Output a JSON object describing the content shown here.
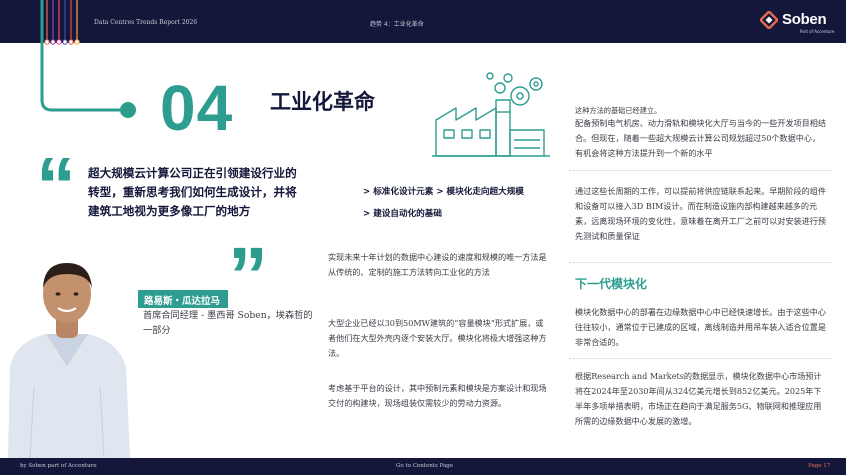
{
  "header": {
    "report": "Data Centres Trends Report 2026",
    "trend": "趋势 4：工业化革命",
    "logo_name": "Soben",
    "logo_sub": "Part of Accenture"
  },
  "section": {
    "number": "04",
    "title": "工业化革命"
  },
  "pull_quote": {
    "open_mark": "“",
    "close_mark": "”",
    "text": "超大规模云计算公司正在引领建设行业的转型，重新思考我们如何生成设计，并将建筑工地视为更多像工厂的地方"
  },
  "person": {
    "name": "路易斯・瓜达拉马",
    "role": "首席合同经理 - 墨西哥 Soben，埃森哲的一部分"
  },
  "bullets": [
    "> 标准化设计元素 > 模块化走向超大规模",
    "> 建设自动化的基础"
  ],
  "middle_paragraphs": [
    "实现未来十年计划的数据中心建设的速度和规模的唯一方法是从传统的、定制的施工方法转向工业化的方法",
    "大型企业已经以30到50MW建筑的“容量模块”形式扩展，或者他们在大型外壳内逐个安装大厅。模块化将极大增强这种方法。",
    "考虑基于平台的设计，其中预制元素和模块是方案设计和现场交付的构建块，现场组装仅需较少的劳动力资源。"
  ],
  "right_column": {
    "lead_in": "这种方法的基础已经建立。",
    "p1": "配备预制电气机房、动力滑轨和模块化大厅与当今的一些开发项目相结合。但现在，随着一些超大规模云计算公司规划超过50个数据中心，有机会将这种方法提升到一个新的水平",
    "p2": "通过这些长周期的工作，可以提前将供应链联系起来。早期阶段的组件和设备可以接入3D BIM设计。而在制造设施内部构建越来越多的元素，远离现场环境的变化性，意味着在离开工厂之前可以对安装进行预先测试和质量保证",
    "heading": "下一代模块化",
    "p3": "模块化数据中心的部署在边缘数据中心中已经快速增长。由于这些中心往往较小，通常位于已建成的区域，离线制造并用吊车装入适合位置是非常合适的。",
    "p4": "根据Research and Markets的数据显示，模块化数据中心市场预计将在2024年至2030年间从324亿美元增长到852亿美元。2025年下半年多项举措表明，市场正在趋向于满足服务5G、物联网和推理应用所需的边缘数据中心发展的激增。"
  },
  "footer": {
    "by": "by Soben part of Accenture",
    "goto": "Go to Contents Page",
    "page": "Page 17"
  },
  "colors": {
    "navy": "#14173a",
    "teal": "#2d9d8f",
    "accent": "#e86b4e"
  }
}
